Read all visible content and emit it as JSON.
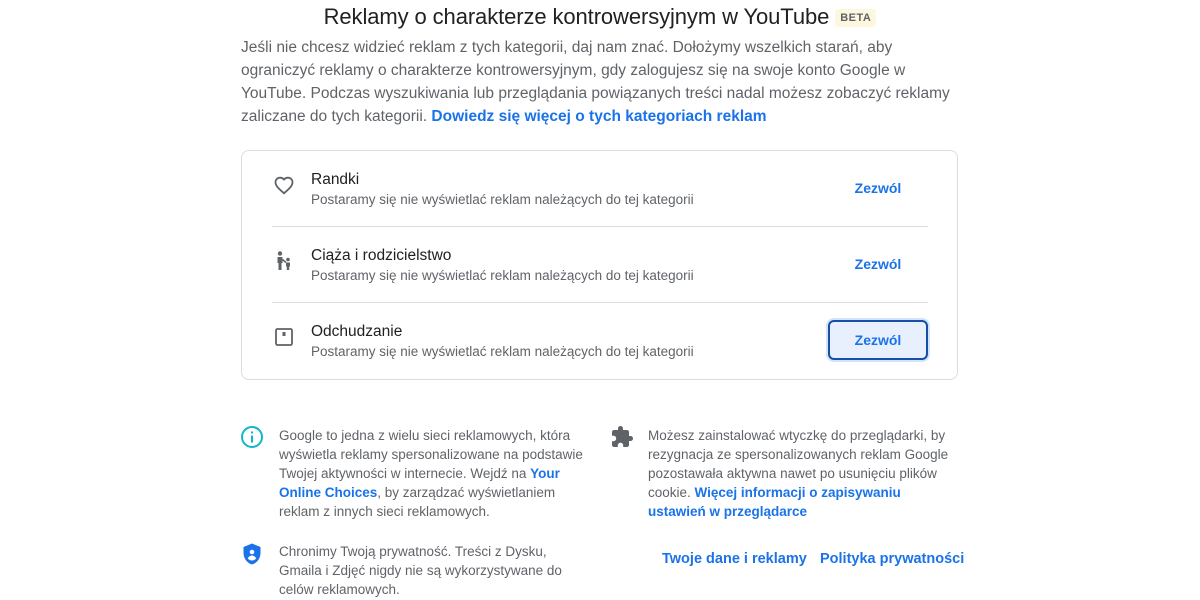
{
  "header": {
    "title": "Reklamy o charakterze kontrowersyjnym w YouTube",
    "badge": "BETA"
  },
  "intro": {
    "text": "Jeśli nie chcesz widzieć reklam z tych kategorii, daj nam znać. Dołożymy wszelkich starań, aby ograniczyć reklamy o charakterze kontrowersyjnym, gdy zalogujesz się na swoje konto Google w YouTube. Podczas wyszukiwania lub przeglądania powiązanych treści nadal możesz zobaczyć reklamy zaliczane do tych kategorii.",
    "link": "Dowiedz się więcej o tych kategoriach reklam"
  },
  "categories": [
    {
      "icon": "heart-icon",
      "title": "Randki",
      "description": "Postaramy się nie wyświetlać reklam należących do tej kategorii",
      "button": "Zezwól"
    },
    {
      "icon": "family-icon",
      "title": "Ciąża i rodzicielstwo",
      "description": "Postaramy się nie wyświetlać reklam należących do tej kategorii",
      "button": "Zezwól"
    },
    {
      "icon": "scale-icon",
      "title": "Odchudzanie",
      "description": "Postaramy się nie wyświetlać reklam należących do tej kategorii",
      "button": "Zezwól"
    }
  ],
  "info": {
    "networks": {
      "icon": "info-icon",
      "text_before": "Google to jedna z wielu sieci reklamowych, która wyświetla reklamy spersonalizowane na podstawie Twojej aktywności w internecie. Wejdź na ",
      "link": "Your Online Choices",
      "text_after": ", by zarządzać wyświetlaniem reklam z innych sieci reklamowych."
    },
    "extension": {
      "icon": "puzzle-icon",
      "text_before": "Możesz zainstalować wtyczkę do przeglądarki, by rezygnacja ze spersonalizowanych reklam Google pozostawała aktywna nawet po usunięciu plików cookie. ",
      "link": "Więcej informacji o zapisywaniu ustawień w przeglądarce"
    },
    "privacy": {
      "icon": "shield-icon",
      "text": "Chronimy Twoją prywatność. Treści z Dysku, Gmaila i Zdjęć nigdy nie są wykorzystywane do celów reklamowych."
    }
  },
  "footer": {
    "data_link": "Twoje dane i reklamy",
    "privacy_link": "Polityka prywatności"
  },
  "colors": {
    "accent": "#1a73e8",
    "text_primary": "#202124",
    "text_secondary": "#5f6368",
    "divider": "#dadce0",
    "info_icon": "#12b5cb",
    "shield_icon": "#1a73e8",
    "badge_bg": "#fef7e0"
  }
}
